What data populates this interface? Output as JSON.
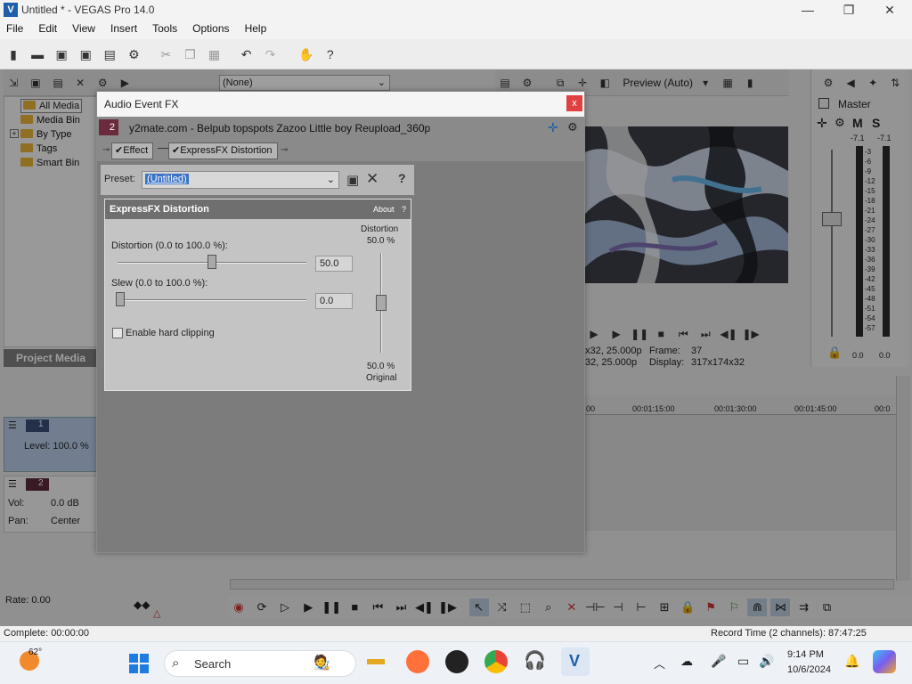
{
  "window": {
    "title": "Untitled * - VEGAS Pro 14.0",
    "app_icon_letter": "V",
    "minimize": "—",
    "maximize": "❐",
    "close": "✕"
  },
  "menu": [
    "File",
    "Edit",
    "View",
    "Insert",
    "Tools",
    "Options",
    "Help"
  ],
  "project_media": {
    "label": "Project Media",
    "tree": [
      {
        "label": "All Media",
        "expand": ""
      },
      {
        "label": "Media Bin",
        "expand": ""
      },
      {
        "label": "By Type",
        "expand": "+"
      },
      {
        "label": "Tags",
        "expand": ""
      },
      {
        "label": "Smart Bin",
        "expand": ""
      }
    ],
    "filter_value": "(None)"
  },
  "preview": {
    "mode": "Preview (Auto)",
    "info_left_1": "x32, 25.000p",
    "info_left_2": "32, 25.000p",
    "frame_label": "Frame:",
    "frame_value": "37",
    "display_label": "Display:",
    "display_value": "317x174x32"
  },
  "master": {
    "label": "Master",
    "m": "M",
    "s": "S",
    "peak_left": "-7.1",
    "peak_right": "-7.1",
    "bottom_left": "0.0",
    "bottom_right": "0.0",
    "scale": [
      "3",
      "6",
      "9",
      "12",
      "15",
      "18",
      "21",
      "24",
      "27",
      "30",
      "33",
      "36",
      "39",
      "42",
      "45",
      "48",
      "51",
      "54",
      "57"
    ]
  },
  "tracks": {
    "track1_number": "1",
    "track1_level": "Level: 100.0 %",
    "track2_number": "2",
    "track2_vol_label": "Vol:",
    "track2_vol_value": "0.0 dB",
    "track2_pan_label": "Pan:",
    "track2_pan_value": "Center"
  },
  "timeline": {
    "ruler": [
      "00",
      "00:01:15:00",
      "00:01:30:00",
      "00:01:45:00",
      "00:0"
    ],
    "rate": "Rate: 0.00"
  },
  "status": {
    "left": "Complete: 00:00:00",
    "right": "Record Time (2 channels): 87:47:25"
  },
  "dialog": {
    "title": "Audio Event FX",
    "close": "x",
    "track_number": "2",
    "event_name": "y2mate.com - Belpub topspots Zazoo  Little boy Reupload_360p",
    "chain_effect": "Effect",
    "chain_plugin": "ExpressFX Distortion",
    "preset_label": "Preset:",
    "preset_value": "(Untitled)",
    "help": "?",
    "plugin_name": "ExpressFX Distortion",
    "about": "About",
    "about_q": "?",
    "distortion_label": "Distortion (0.0 to 100.0 %):",
    "distortion_value": "50.0",
    "slew_label": "Slew (0.0 to 100.0 %):",
    "slew_value": "0.0",
    "hard_clip_label": "Enable hard clipping",
    "mix_top_label": "Distortion",
    "mix_top_value": "50.0 %",
    "mix_bottom_value": "50.0 %",
    "mix_bottom_label": "Original"
  },
  "taskbar": {
    "weather_temp": "62°",
    "search_placeholder": "Search",
    "time": "9:14 PM",
    "date": "10/6/2024"
  },
  "levels": {
    "distortion": 0.5,
    "slew": 0.0,
    "mix": 0.5
  }
}
